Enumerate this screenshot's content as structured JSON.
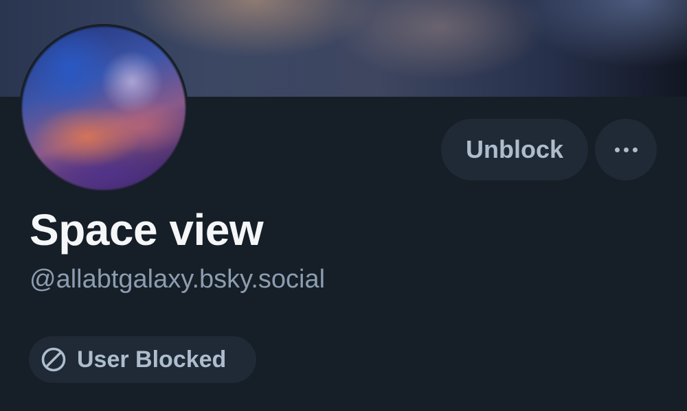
{
  "profile": {
    "display_name": "Space view",
    "handle": "@allabtgalaxy.bsky.social"
  },
  "actions": {
    "unblock_label": "Unblock",
    "more_icon": "ellipsis-icon"
  },
  "status_badge": {
    "label": "User Blocked",
    "icon": "block-icon"
  },
  "colors": {
    "background": "#161e27",
    "button_background": "#1f2a36",
    "button_text": "#aebdcd",
    "name_text": "#f4f6f8",
    "handle_text": "#8c9db0"
  }
}
